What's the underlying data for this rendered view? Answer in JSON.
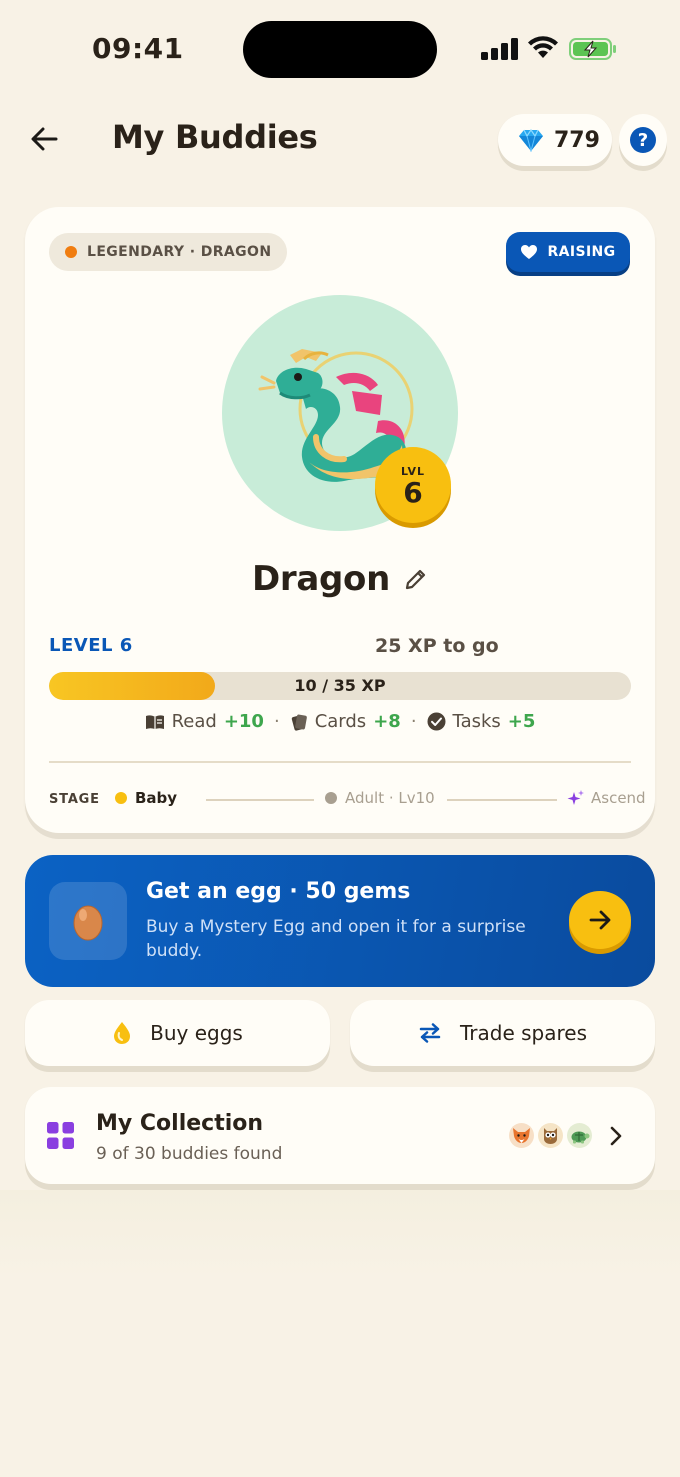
{
  "status_bar": {
    "time": "09:41"
  },
  "header": {
    "title": "My Buddies",
    "gems": "779",
    "help": "?"
  },
  "buddy": {
    "rarity": "LEGENDARY · DRAGON",
    "status_button": "RAISING",
    "name": "Dragon",
    "badge_label": "LVL",
    "badge_level": "6",
    "level_label": "LEVEL 6",
    "xp_to_go": "25 XP to go",
    "xp_text": "10 / 35 XP",
    "xp_progress": 0.2857,
    "sources": [
      {
        "label": "Read",
        "bonus": "+10",
        "icon": "book-icon"
      },
      {
        "label": "Cards",
        "bonus": "+8",
        "icon": "cards-icon"
      },
      {
        "label": "Tasks",
        "bonus": "+5",
        "icon": "check-circle-icon"
      }
    ],
    "stage": {
      "label": "STAGE",
      "current": "Baby",
      "next": "Adult · Lv10",
      "final": "Ascend"
    }
  },
  "egg_offer": {
    "title": "Get an egg · 50 gems",
    "description": "Buy a Mystery Egg and open it for a surprise buddy."
  },
  "actions": {
    "buy": "Buy eggs",
    "trade": "Trade spares"
  },
  "collection": {
    "title": "My Collection",
    "subtitle": "9 of 30 buddies found",
    "preview_icons": [
      "fox-icon",
      "owl-icon",
      "turtle-icon"
    ]
  },
  "colors": {
    "background": "#f8f2e6",
    "primary_blue": "#0a57b6",
    "gold": "#f8bf10",
    "green_bonus": "#3ea64d",
    "accent_purple": "#8a3fe0"
  }
}
